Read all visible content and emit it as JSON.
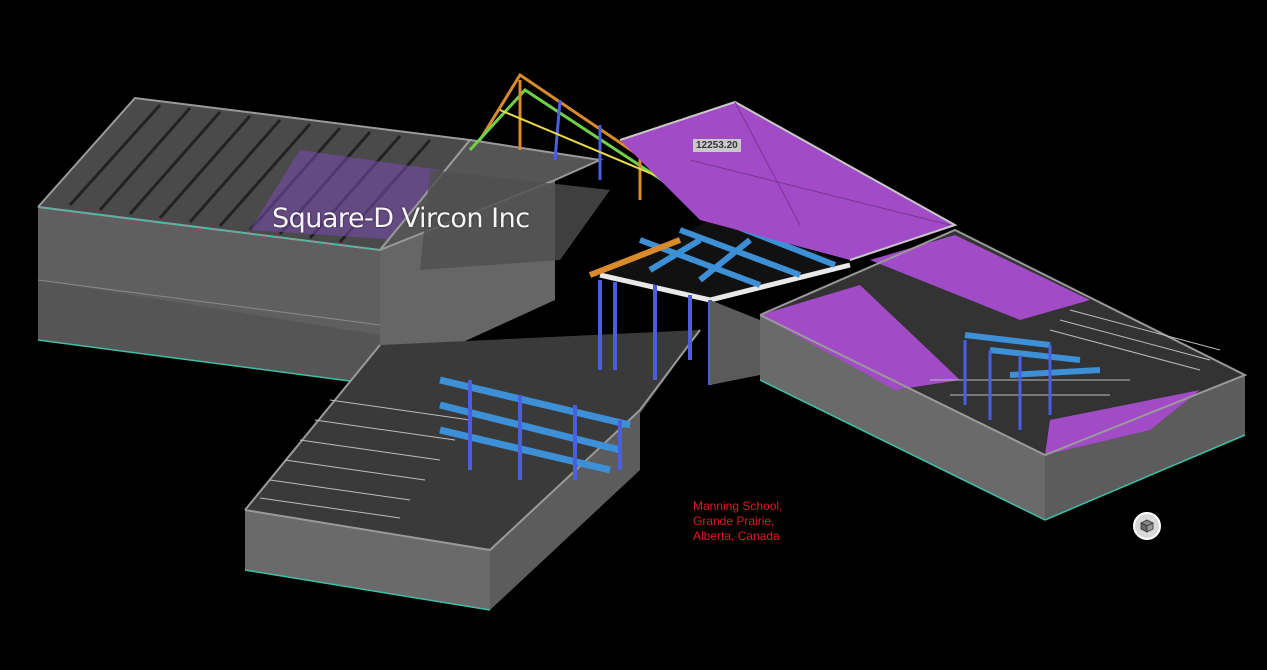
{
  "viewer": {
    "watermark": "Square-D Vircon Inc",
    "dimension_label": "12253.20",
    "location_lines": [
      "Manning School,",
      "Grande Prairie,",
      "Alberta, Canada"
    ],
    "view_cube_icon": "cube-icon"
  },
  "colors": {
    "background": "#000000",
    "wall": "#6e6e6e",
    "roof": "#a24bc7",
    "beam": "#3d8fd6",
    "column": "#4a5ee0",
    "location_text": "#e11a1a"
  }
}
